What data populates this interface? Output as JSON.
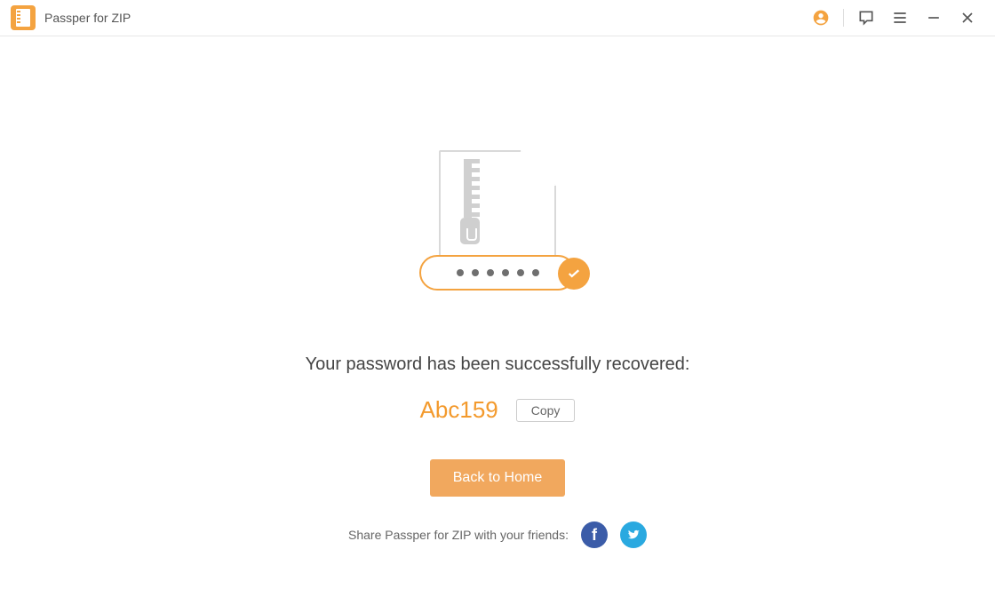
{
  "titlebar": {
    "app_name": "Passper for ZIP"
  },
  "main": {
    "success_message": "Your password has been successfully recovered:",
    "recovered_password": "Abc159",
    "copy_label": "Copy",
    "home_button_label": "Back to Home",
    "share_text": "Share Passper for ZIP with your friends:"
  }
}
